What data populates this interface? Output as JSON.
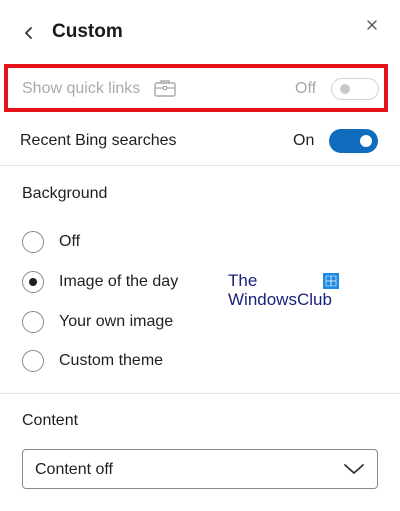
{
  "header": {
    "back_glyph": "‹",
    "title": "Custom",
    "close_glyph": "×"
  },
  "quick_links": {
    "label": "Show quick links",
    "icon": "briefcase-icon",
    "state_label": "Off",
    "enabled": false,
    "highlight_color": "#e8141b"
  },
  "bing_searches": {
    "label": "Recent Bing searches",
    "state_label": "On",
    "enabled": true,
    "accent_color": "#0f6cbd"
  },
  "background": {
    "title": "Background",
    "options": [
      {
        "label": "Off",
        "selected": false
      },
      {
        "label": "Image of the day",
        "selected": true
      },
      {
        "label": "Your own image",
        "selected": false
      },
      {
        "label": "Custom theme",
        "selected": false
      }
    ]
  },
  "watermark": {
    "line1": "The",
    "line2": "WindowsClub"
  },
  "content": {
    "title": "Content",
    "selected_value": "Content off"
  }
}
